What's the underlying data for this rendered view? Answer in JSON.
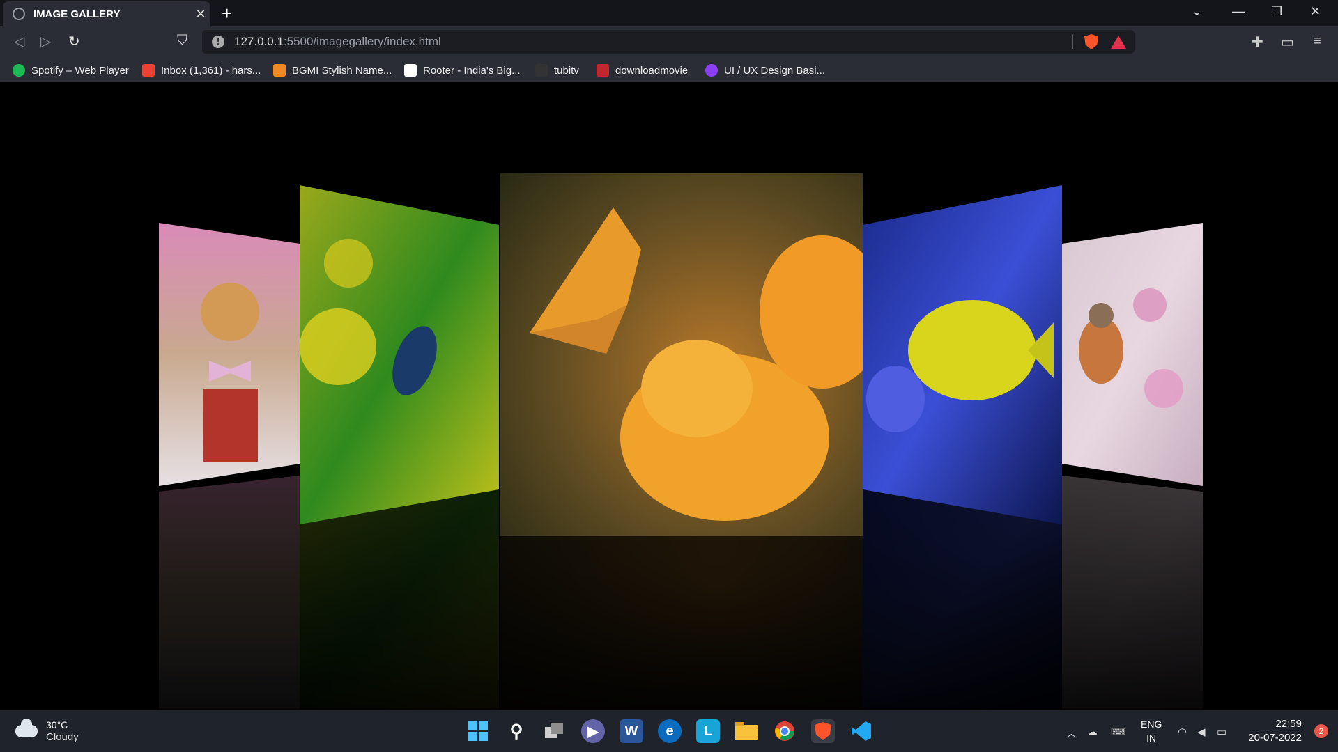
{
  "browser": {
    "tab_title": "IMAGE GALLERY",
    "url_host": "127.0.0.1",
    "url_path": ":5500/imagegallery/index.html",
    "bookmarks": [
      {
        "label": "Spotify – Web Player",
        "color": "#1db954"
      },
      {
        "label": "Inbox (1,361) - hars...",
        "color": "#ea4335"
      },
      {
        "label": "BGMI Stylish Name...",
        "color": "#f08a24"
      },
      {
        "label": "Rooter - India's Big...",
        "color": "#ffffff"
      },
      {
        "label": "tubitv",
        "color": "#333333"
      },
      {
        "label": "downloadmovie",
        "color": "#c0282d"
      },
      {
        "label": "UI / UX Design Basi...",
        "color": "#8a3ff5"
      }
    ]
  },
  "gallery": {
    "images": [
      {
        "subject": "puppy in gift box"
      },
      {
        "subject": "butterfly on yellow flowers"
      },
      {
        "subject": "butterfly on orange flower"
      },
      {
        "subject": "yellow tang fish"
      },
      {
        "subject": "robin bird on blossom"
      }
    ]
  },
  "taskbar": {
    "temperature": "30°C",
    "weather": "Cloudy",
    "lang_top": "ENG",
    "lang_bottom": "IN",
    "time": "22:59",
    "date": "20-07-2022",
    "notifications": "2"
  }
}
